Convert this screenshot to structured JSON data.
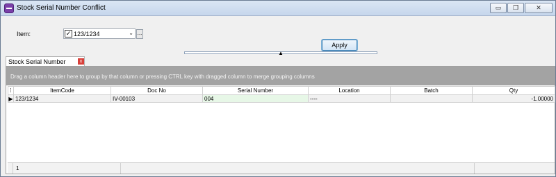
{
  "window": {
    "title": "Stock Serial Number Conflict",
    "buttons": {
      "minimize": "▭",
      "restore": "❐",
      "close": "✕"
    }
  },
  "filter": {
    "item_label": "Item:",
    "item_checked": "✓",
    "item_value": "123/1234",
    "dropdown_icon": "⌄",
    "ellipsis_label": "...",
    "apply_label": "Apply",
    "splitter_icon": "▲"
  },
  "tab": {
    "label": "Stock Serial Number Conflict",
    "close": "x"
  },
  "grid": {
    "group_hint": "Drag a column header here to group by that column or pressing CTRL key with dragged column to merge grouping columns",
    "header_indicator": "⁞",
    "columns": [
      "ItemCode",
      "Doc No",
      "Serial Number",
      "Location",
      "Batch",
      "Qty"
    ],
    "rows": [
      {
        "indicator": "▶",
        "itemcode": "123/1234",
        "docno": "IV-00103",
        "serial": "004",
        "location": "----",
        "batch": "",
        "qty": "-1.00000"
      }
    ],
    "footer_count": "1"
  }
}
